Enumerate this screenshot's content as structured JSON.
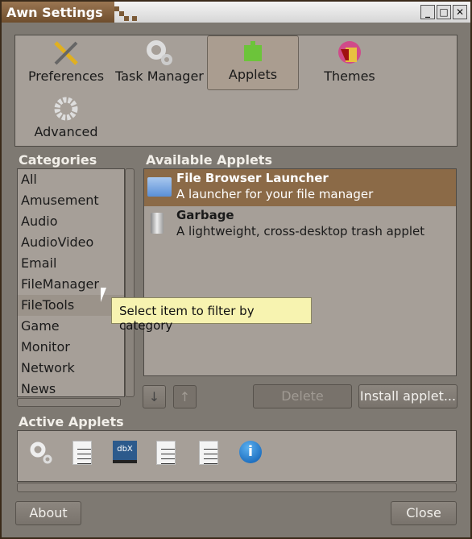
{
  "window": {
    "title": "Awn Settings",
    "controls": [
      "_",
      "□",
      "✕"
    ]
  },
  "toolbar": {
    "items": [
      {
        "label": "Preferences",
        "icon": "tools-icon"
      },
      {
        "label": "Task Manager",
        "icon": "gears-icon"
      },
      {
        "label": "Applets",
        "icon": "puzzle-icon",
        "selected": true
      },
      {
        "label": "Themes",
        "icon": "paint-bucket-icon"
      },
      {
        "label": "Advanced",
        "icon": "gear-icon"
      }
    ]
  },
  "categories": {
    "header": "Categories",
    "items": [
      "All",
      "Amusement",
      "Audio",
      "AudioVideo",
      "Email",
      "FileManager",
      "FileTools",
      "Game",
      "Monitor",
      "Network",
      "News"
    ],
    "hovered": "FileTools"
  },
  "available": {
    "header": "Available Applets",
    "items": [
      {
        "name": "File Browser Launcher",
        "desc": "A launcher for your file manager",
        "icon": "folder-icon",
        "selected": true
      },
      {
        "name": "Garbage",
        "desc": "A lightweight, cross-desktop trash applet",
        "icon": "trash-icon"
      }
    ]
  },
  "tooltip": "Select item to filter by category",
  "buttons": {
    "move_down": "↓",
    "move_up": "↑",
    "delete": "Delete",
    "install": "Install applet...",
    "about": "About",
    "close": "Close"
  },
  "active": {
    "header": "Active Applets",
    "icons": [
      "gears-icon",
      "document-icon",
      "dbx-icon",
      "document-icon",
      "document-icon",
      "info-icon"
    ],
    "dbx_label": "dbX",
    "info_label": "i"
  }
}
